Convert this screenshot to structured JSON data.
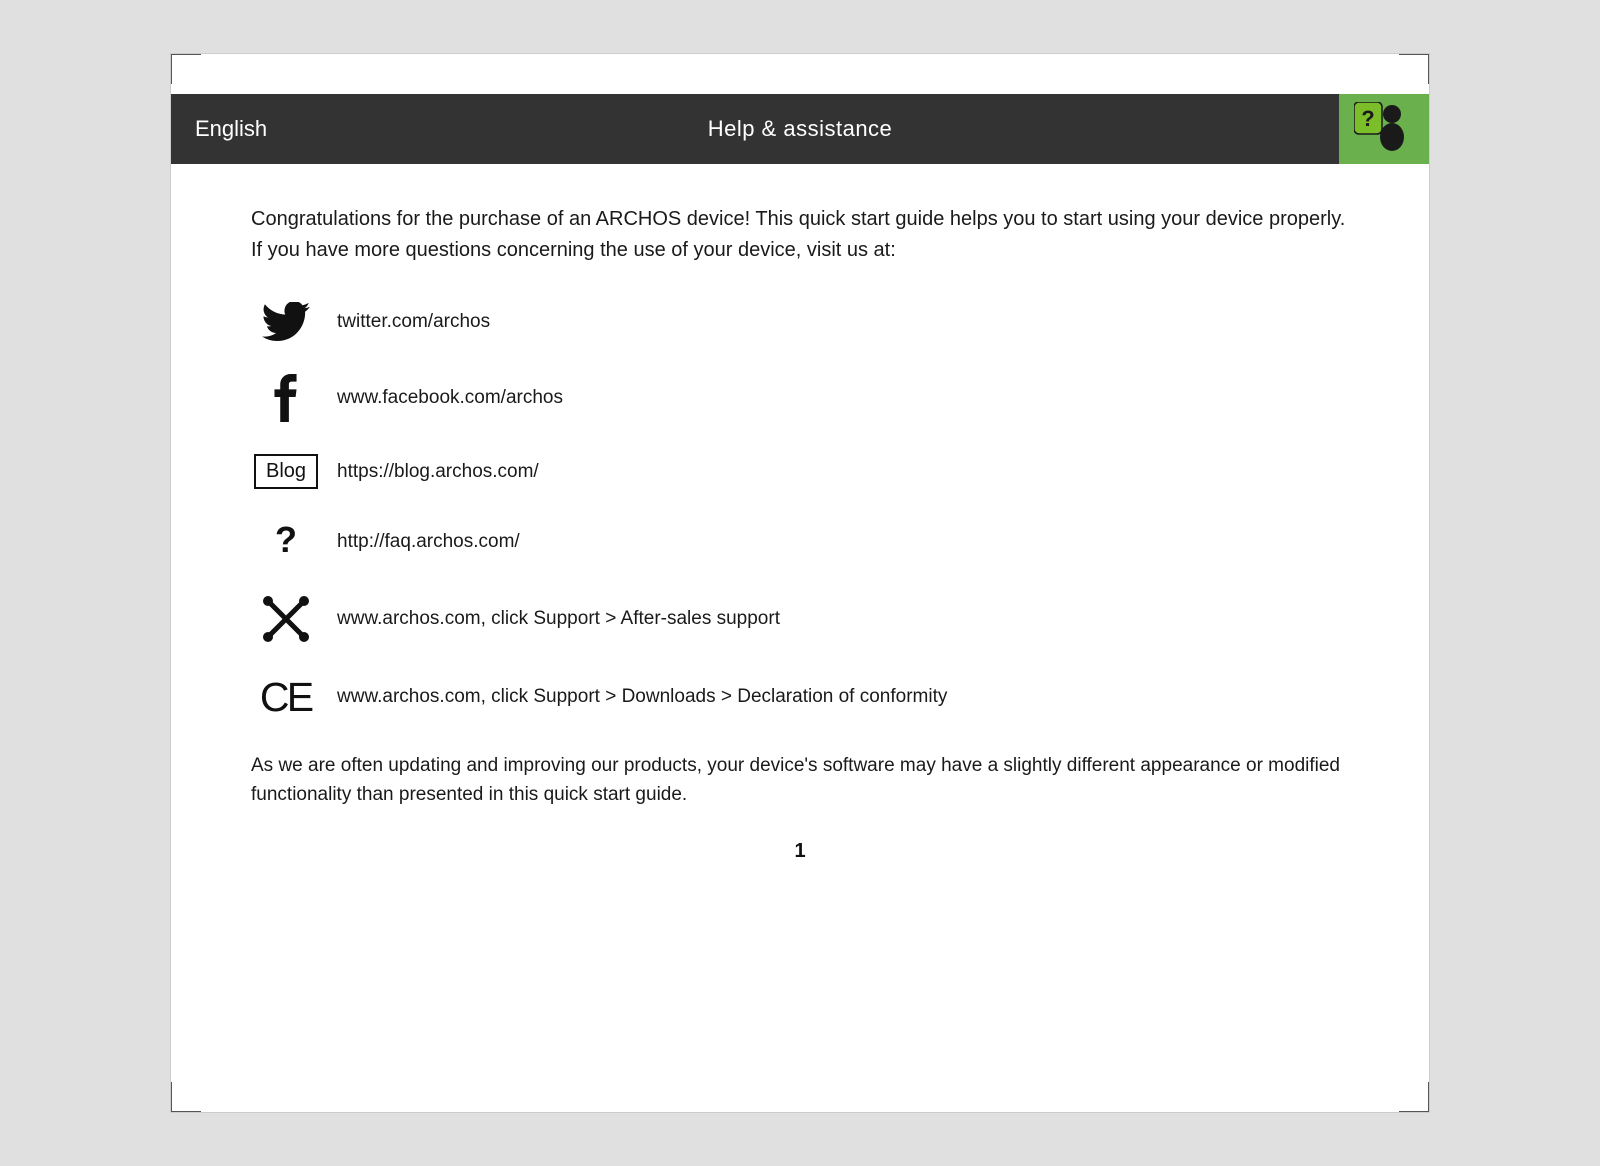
{
  "header": {
    "language": "English",
    "title": "Help & assistance",
    "icon_label": "help-person-icon"
  },
  "content": {
    "intro": "Congratulations for the purchase of an ARCHOS device! This quick start guide helps you to start using your device properly. If you have more questions concerning the use of your device, visit us at:",
    "links": [
      {
        "icon": "twitter",
        "text": "twitter.com/archos"
      },
      {
        "icon": "facebook",
        "text": "www.facebook.com/archos"
      },
      {
        "icon": "blog",
        "text": "https://blog.archos.com/"
      },
      {
        "icon": "faq",
        "text": "http://faq.archos.com/"
      },
      {
        "icon": "tools",
        "text": "www.archos.com, click Support > After-sales support"
      },
      {
        "icon": "ce",
        "text": "www.archos.com, click Support > Downloads > Declaration of conformity"
      }
    ],
    "footer": "As we are often updating and improving our products, your device's software may have a slightly different appearance or modified functionality than presented in this quick start guide.",
    "page_number": "1"
  },
  "colors": {
    "header_bg": "#333333",
    "icon_bg": "#7cbd2a",
    "text": "#1a1a1a",
    "white": "#ffffff"
  }
}
